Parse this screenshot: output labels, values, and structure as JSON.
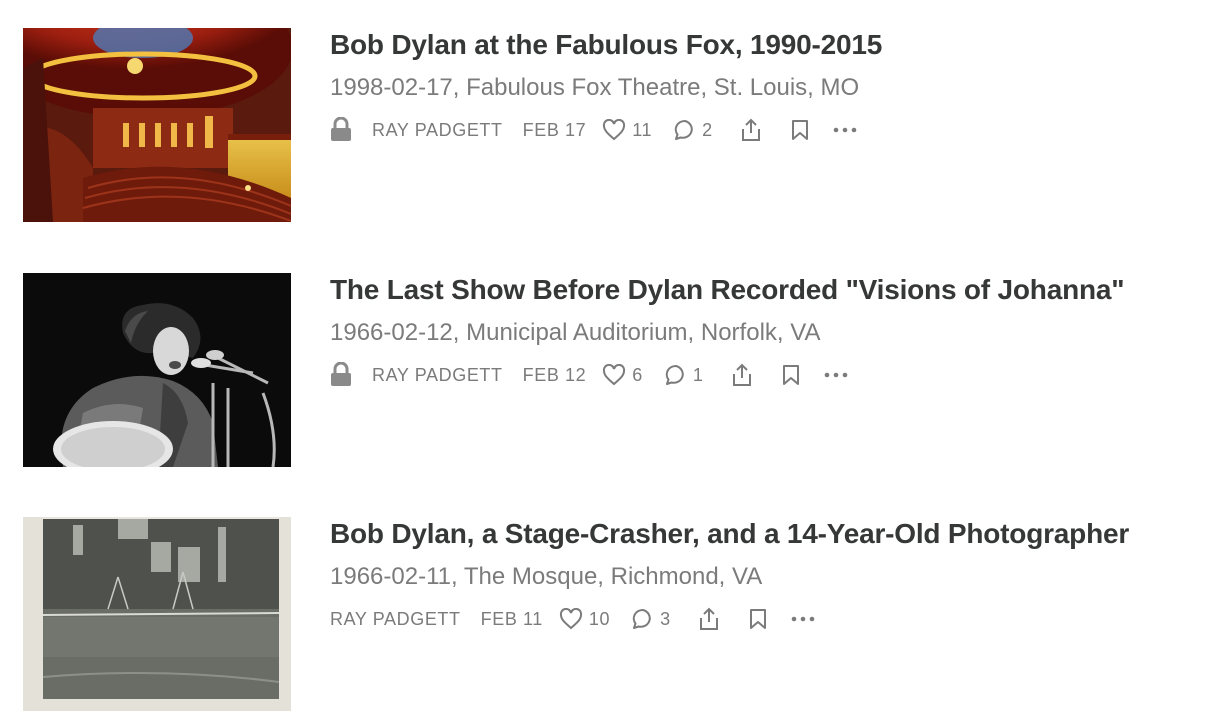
{
  "posts": [
    {
      "title": "Bob Dylan at the Fabulous Fox, 1990-2015",
      "subtitle": "1998-02-17, Fabulous Fox Theatre, St. Louis, MO",
      "locked": true,
      "author": "RAY PADGETT",
      "date": "FEB 17",
      "likes": "11",
      "comments": "2",
      "image": "theater-interior-photo"
    },
    {
      "title": "The Last Show Before Dylan Recorded \"Visions of Johanna\"",
      "subtitle": "1966-02-12, Municipal Auditorium, Norfolk, VA",
      "locked": true,
      "author": "RAY PADGETT",
      "date": "FEB 12",
      "likes": "6",
      "comments": "1",
      "image": "performer-with-guitar-photo"
    },
    {
      "title": "Bob Dylan, a Stage-Crasher, and a 14-Year-Old Photographer",
      "subtitle": "1966-02-11, The Mosque, Richmond, VA",
      "locked": false,
      "author": "RAY PADGETT",
      "date": "FEB 11",
      "likes": "10",
      "comments": "3",
      "image": "vintage-stage-photo"
    }
  ],
  "icons": {
    "lock": "lock-icon",
    "like": "heart-icon",
    "comment": "comment-bubble-icon",
    "share": "share-icon",
    "bookmark": "bookmark-icon",
    "more": "more-options-icon"
  },
  "colors": {
    "title": "#363737",
    "meta": "#7b7b7b"
  }
}
